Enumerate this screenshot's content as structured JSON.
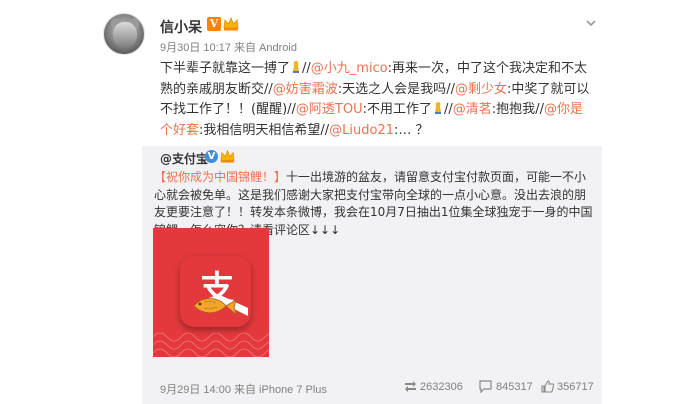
{
  "post": {
    "username": "信小呆",
    "meta": "9月30日 10:17 来自 Android",
    "text_parts": {
      "p1": "下半辈子就靠这一搏了",
      "p2": "//",
      "m1": "@小九_mico",
      "p3": ":再来一次，中了这个我决定和不太熟的亲戚朋友断交",
      "p4": "//",
      "m2": "@妨害霜波",
      "p5": ":天选之人会是我吗",
      "p6": "//",
      "m3": "@剩少女",
      "p7": ":中奖了就可以不找工作了！！(醒醒",
      "p8": ")//",
      "m4": "@阿透TOU",
      "p9": ":不用工作了",
      "p10": "//",
      "m5": "@清茗",
      "p11": ":抱抱我",
      "p12": "//",
      "m6": "@你是个好套",
      "p13": ":我相信明天相信希望",
      "p14": "//",
      "m7": "@Liudo21",
      "p15": ":… ？"
    }
  },
  "repost": {
    "author": "@支付宝",
    "text_tag": "【祝你成为中国锦鲤！】",
    "text_body": "十一出境游的盆友，请留意支付宝付款页面，可能一不小心就会被免单。这是我们感谢大家把支付宝带向全球的一点小心意。没出去浪的朋友更要注意了！！转发本条微博，我会在10月7日抽出1位集全球独宠于一身的中国锦鲤，怎么宠你？请看评论区↓↓↓",
    "image_glyph": "支",
    "meta": "9月29日 14:00 来自 iPhone 7 Plus",
    "stats": {
      "reposts": "2632306",
      "comments": "845317",
      "likes": "356717"
    }
  },
  "colors": {
    "mention": "#eb7350",
    "brand_red": "#e4393c",
    "vip_orange": "#ff8200",
    "vip_blue": "#3f8fd8",
    "meta_gray": "#808080"
  },
  "icons": [
    "vip-icon",
    "crown-icon",
    "chevron-down-icon",
    "emoji-icon",
    "repost-icon",
    "comment-icon",
    "like-icon"
  ]
}
